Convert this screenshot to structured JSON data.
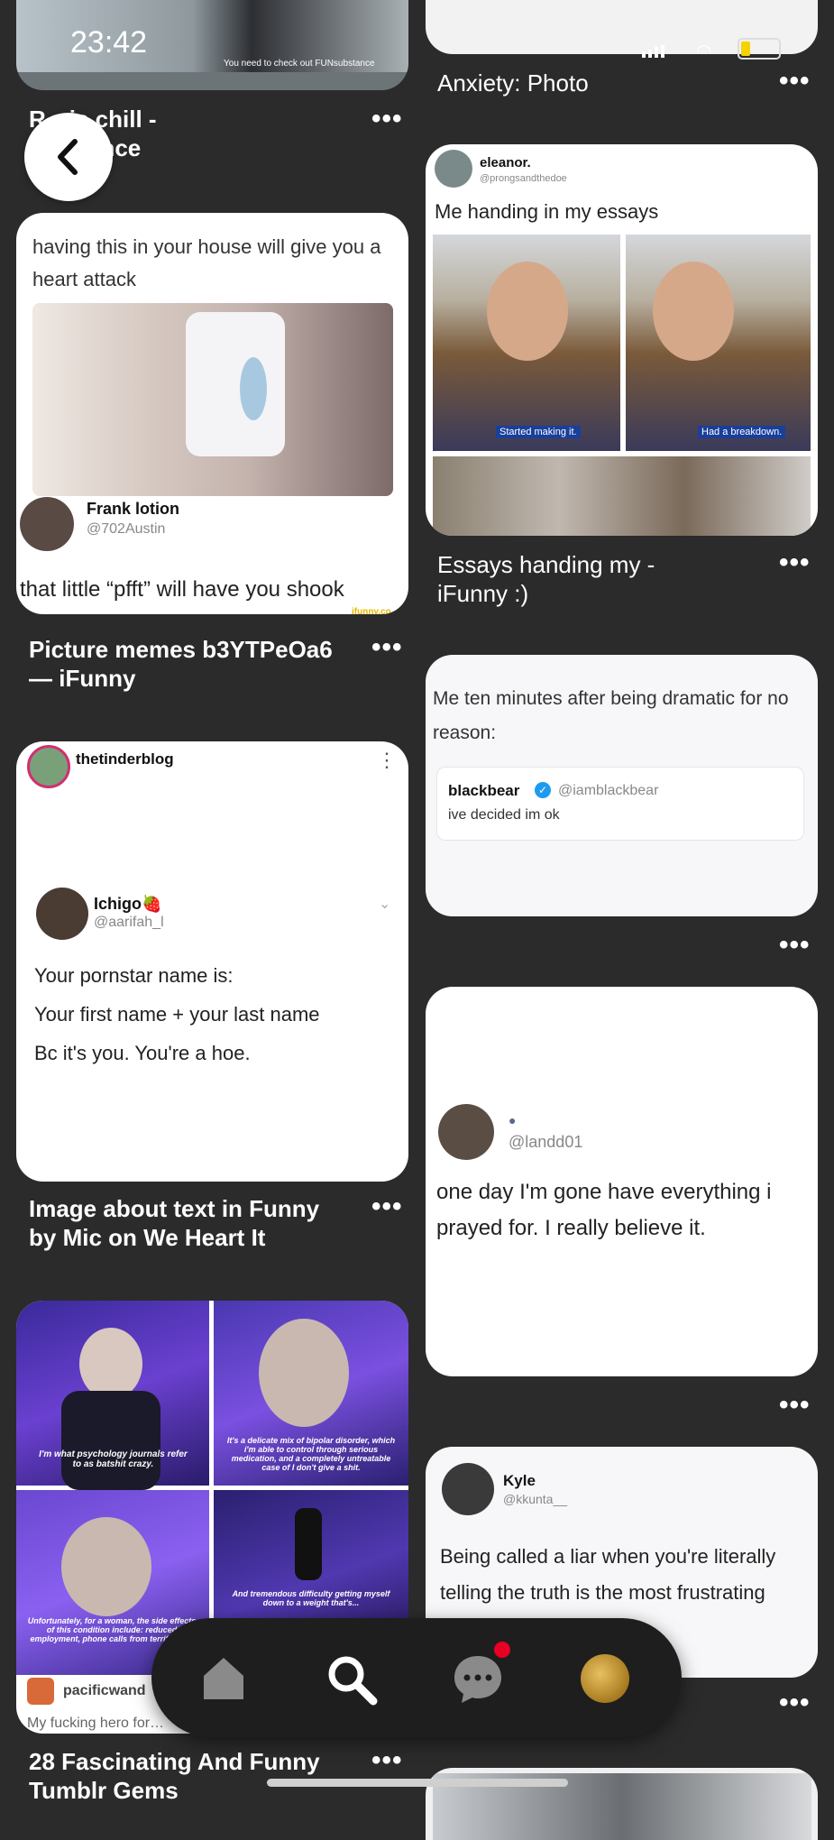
{
  "status_bar": {
    "time": "23:42"
  },
  "back_label": "‹",
  "left_col": [
    {
      "caption_line1": "R…is chill -",
      "caption_line2": "…bstance",
      "banner_text": "You need to check out FUNsubstance"
    },
    {
      "title_text": "having this in your house will give you a heart attack",
      "author_name": "Frank lotion",
      "author_handle": "@702Austin",
      "body_text": "that little “pfft” will have you shook",
      "watermark": "ifunny.co",
      "caption_line1": "Picture memes b3YTPeOa6",
      "caption_line2": "— iFunny"
    },
    {
      "header_name": "thetinderblog",
      "author_name": "Ichigo🍓",
      "author_handle": "@aarifah_l",
      "line1": "Your pornstar name is:",
      "line2": "Your first name + your last name",
      "line3": "Bc it's you. You're a hoe.",
      "caption_line1": "Image about text in Funny",
      "caption_line2": "by Mic on We Heart It"
    },
    {
      "sub1": "I'm what psychology journals refer to as batshit crazy.",
      "sub2": "It's a delicate mix of bipolar disorder, which i'm able to control through serious medication, and a completely untreatable case of I don't give a shit.",
      "sub3": "Unfortunately, for a woman, the side effects of this condition include: reduced employment, phone calls from terrified P...",
      "sub4": "And tremendous difficulty getting myself down to a weight that's...",
      "footer_name": "pacificwand",
      "footer_text": "My fucking hero for…",
      "caption_line1": "28 Fascinating And Funny",
      "caption_line2": "Tumblr Gems"
    }
  ],
  "right_col": [
    {
      "caption_line1": "Anxiety: Photo"
    },
    {
      "author_name": "eleanor.",
      "author_handle": "@prongsandthedoe",
      "title_text": "Me handing in my essays",
      "sub_left": "Started making it.",
      "sub_right": "Had a breakdown.",
      "caption_line1": "Essays handing my -",
      "caption_line2": "iFunny :)"
    },
    {
      "title_text": "Me ten minutes after being dramatic for no reason:",
      "quote_name": "blackbear",
      "quote_handle": "@iamblackbear",
      "quote_text": "ive decided im ok"
    },
    {
      "author_handle": "@landd01",
      "body_text": "one day I'm gone have everything i prayed for. I really believe it."
    },
    {
      "author_name": "Kyle",
      "author_handle": "@kkunta__",
      "body_text": "Being called a liar when you're literally telling the truth is the most frustrating thi…"
    }
  ],
  "dots_label": "•••",
  "nav": {
    "active": "search",
    "notification_color": "#e60023"
  }
}
